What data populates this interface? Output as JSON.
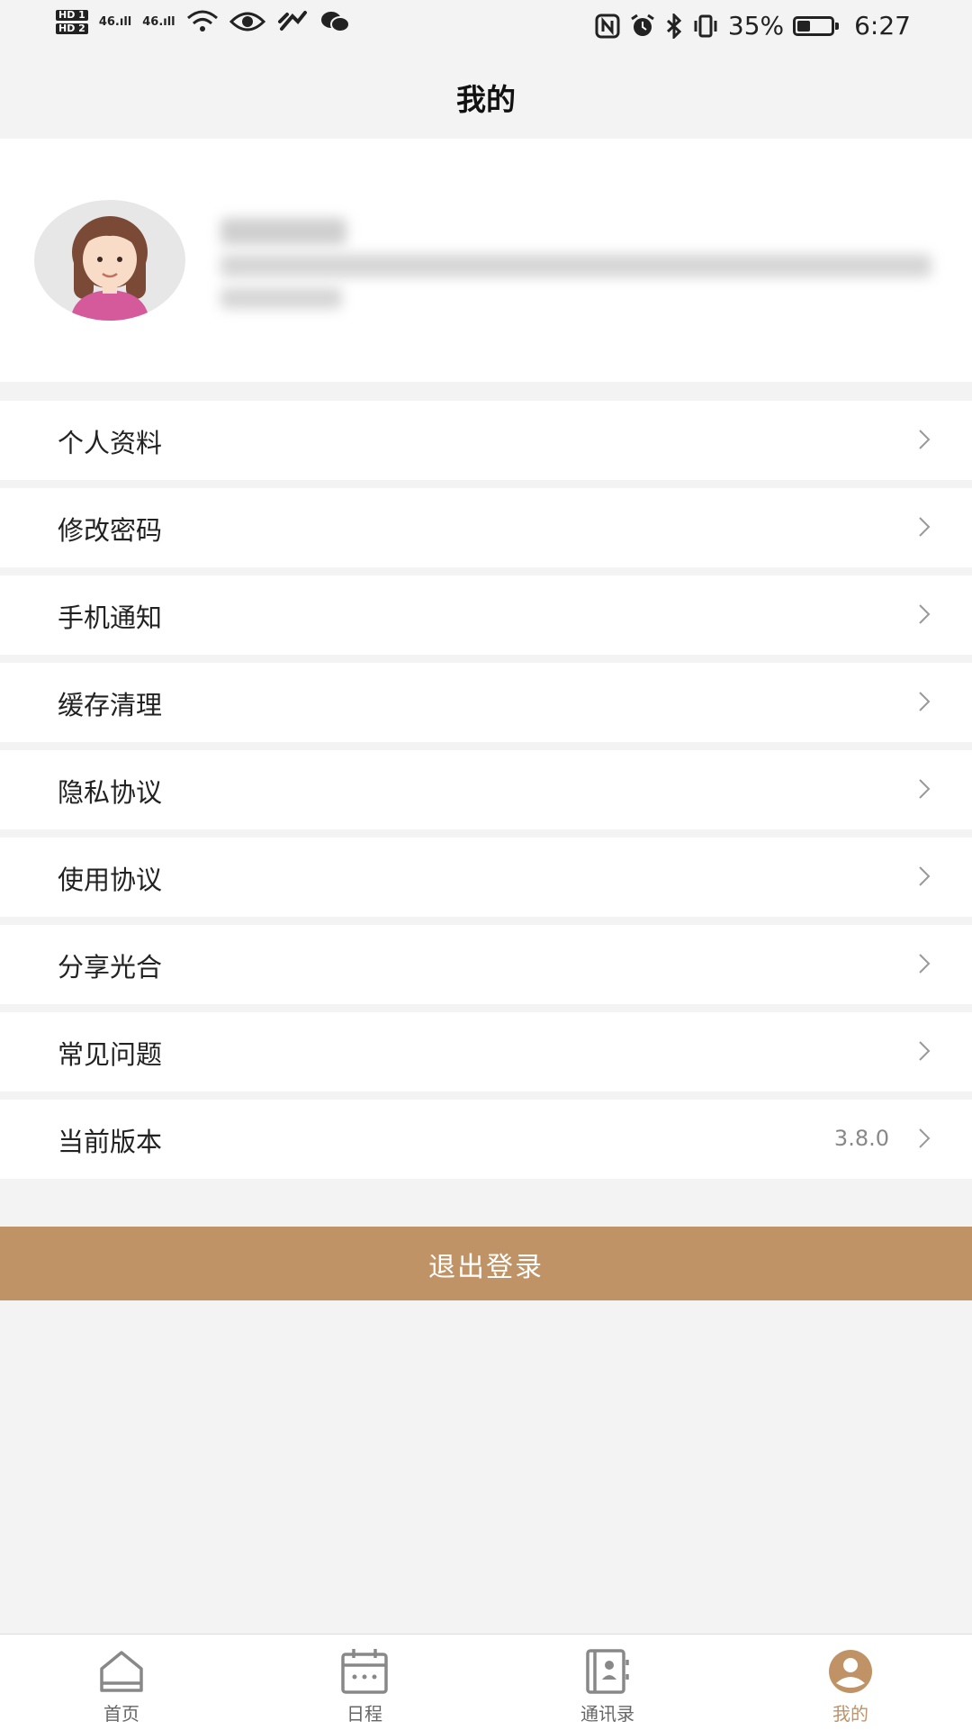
{
  "status_bar": {
    "hd1": "HD 1",
    "hd2": "HD 2",
    "signal1": "46.ıll",
    "signal2": "46.ıll",
    "battery": "35%",
    "time": "6:27",
    "icons": [
      "wifi-icon",
      "eye-icon",
      "link-icon",
      "wechat-icon",
      "nfc-icon",
      "alarm-icon",
      "bluetooth-icon",
      "vibrate-icon",
      "battery-icon"
    ]
  },
  "header": {
    "title": "我的"
  },
  "profile": {
    "avatar": "avatar-girl",
    "name_redacted": true
  },
  "menu": {
    "items": [
      {
        "label": "个人资料"
      },
      {
        "label": "修改密码"
      },
      {
        "label": "手机通知"
      },
      {
        "label": "缓存清理"
      },
      {
        "label": "隐私协议"
      },
      {
        "label": "使用协议"
      },
      {
        "label": "分享光合"
      },
      {
        "label": "常见问题"
      },
      {
        "label": "当前版本",
        "value": "3.8.0"
      }
    ]
  },
  "logout": {
    "label": "退出登录"
  },
  "tabs": [
    {
      "label": "首页",
      "icon": "home-icon"
    },
    {
      "label": "日程",
      "icon": "calendar-icon"
    },
    {
      "label": "通讯录",
      "icon": "contacts-icon"
    },
    {
      "label": "我的",
      "icon": "user-icon",
      "active": true
    }
  ],
  "colors": {
    "accent": "#bf9366",
    "background": "#f3f3f3",
    "tab_inactive": "#666666"
  }
}
